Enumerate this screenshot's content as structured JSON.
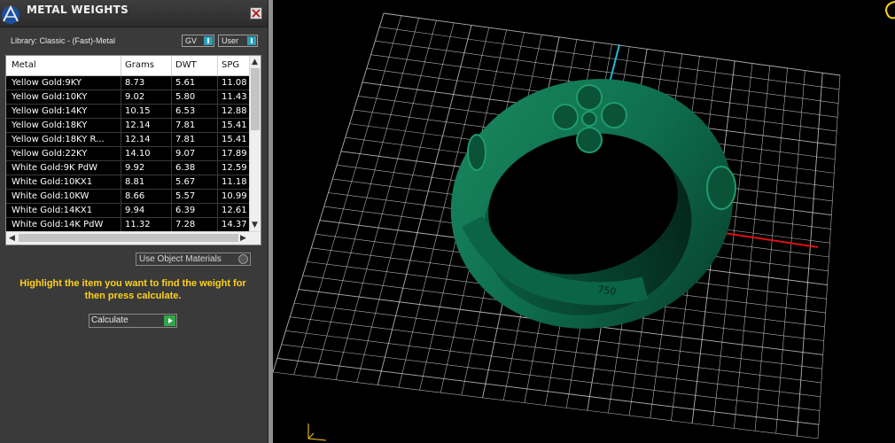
{
  "panel": {
    "title": "METAL WEIGHTS",
    "library_label": "Library: Classic - (Fast)-Metal",
    "gv_label": "GV",
    "user_label": "User",
    "use_object_materials_label": "Use Object Materials",
    "hint_text": "Highlight the item you want to find the weight for then press calculate.",
    "calculate_label": "Calculate"
  },
  "table": {
    "columns": [
      "Metal",
      "Grams",
      "DWT",
      "SPG"
    ],
    "rows": [
      [
        "Yellow Gold:9KY",
        "8.73",
        "5.61",
        "11.08"
      ],
      [
        "Yellow Gold:10KY",
        "9.02",
        "5.80",
        "11.43"
      ],
      [
        "Yellow Gold:14KY",
        "10.15",
        "6.53",
        "12.88"
      ],
      [
        "Yellow Gold:18KY",
        "12.14",
        "7.81",
        "15.41"
      ],
      [
        "Yellow Gold:18KY R...",
        "12.14",
        "7.81",
        "15.41"
      ],
      [
        "Yellow Gold:22KY",
        "14.10",
        "9.07",
        "17.89"
      ],
      [
        "White Gold:9K PdW",
        "9.92",
        "6.38",
        "12.59"
      ],
      [
        "White Gold:10KX1",
        "8.81",
        "5.67",
        "11.18"
      ],
      [
        "White Gold:10KW",
        "8.66",
        "5.57",
        "10.99"
      ],
      [
        "White Gold:14KX1",
        "9.94",
        "6.39",
        "12.61"
      ],
      [
        "White Gold:14K PdW",
        "11.32",
        "7.28",
        "14.37"
      ]
    ]
  },
  "viewport": {
    "ring_stamp": "750",
    "colors": {
      "ring": "#0e6e4e",
      "grid": "#cfcfcf",
      "x_axis": "#e01010",
      "z_axis": "#22b8d8",
      "accent_yellow": "#ffd21a"
    }
  }
}
